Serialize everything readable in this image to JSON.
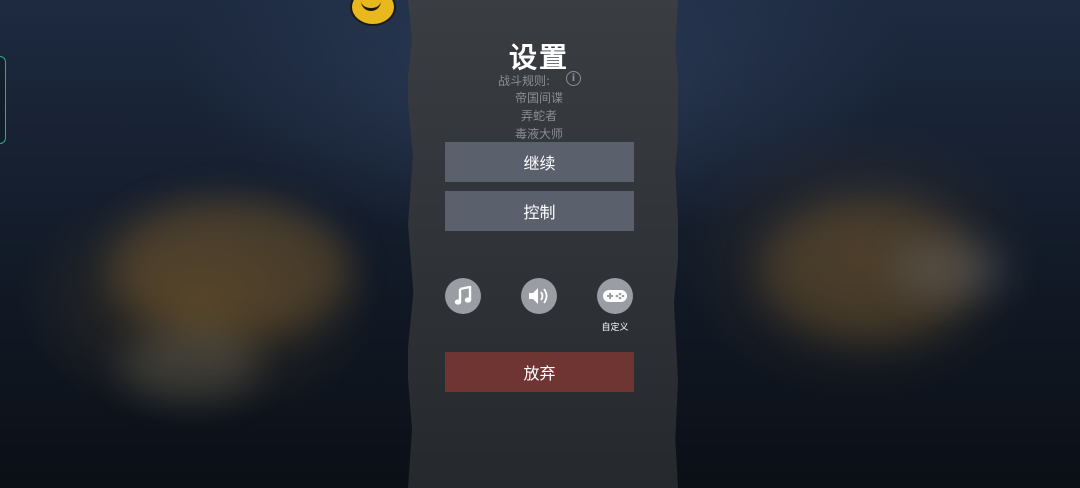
{
  "screen": {
    "title": "设置",
    "rules_label": "战斗规则:",
    "rules": [
      "帝国间谍",
      "弄蛇者",
      "毒液大师"
    ]
  },
  "buttons": {
    "continue_label": "继续",
    "controls_label": "控制",
    "quit_label": "放弃"
  },
  "icons": {
    "music": "music-note-icon",
    "sound": "speaker-icon",
    "gamepad": "gamepad-icon",
    "gamepad_label": "自定义"
  },
  "colors": {
    "button": "#5a606c",
    "quit_button": "#6f3533",
    "icon_circle": "#9a9ea4"
  }
}
